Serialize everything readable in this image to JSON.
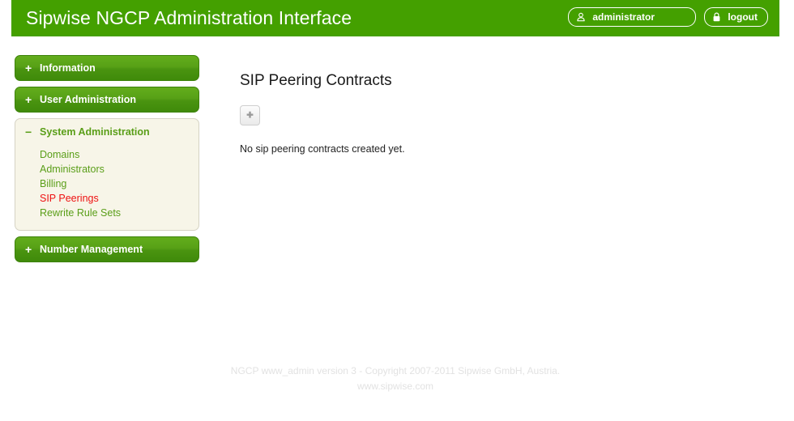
{
  "header": {
    "title": "Sipwise NGCP Administration Interface",
    "brand_green": "#44a000",
    "user_button": {
      "label": "administrator",
      "icon": "user-icon"
    },
    "logout_button": {
      "label": "logout",
      "icon": "lock-icon"
    }
  },
  "sidebar": {
    "items": [
      {
        "label": "Information",
        "sign": "+",
        "expanded": false
      },
      {
        "label": "User Administration",
        "sign": "+",
        "expanded": false
      },
      {
        "label": "System Administration",
        "sign": "−",
        "expanded": true,
        "children": [
          {
            "label": "Domains",
            "active": false
          },
          {
            "label": "Administrators",
            "active": false
          },
          {
            "label": "Billing",
            "active": false
          },
          {
            "label": "SIP Peerings",
            "active": true
          },
          {
            "label": "Rewrite Rule Sets",
            "active": false
          }
        ]
      },
      {
        "label": "Number Management",
        "sign": "+",
        "expanded": false
      }
    ],
    "active_color": "#ee1111",
    "link_color": "#5a9e18"
  },
  "main": {
    "title": "SIP Peering Contracts",
    "add_button": {
      "label": "+",
      "icon": "plus-icon"
    },
    "empty_message": "No sip peering contracts created yet."
  },
  "footer": {
    "line1": "NGCP www_admin version 3 - Copyright 2007-2011 Sipwise GmbH, Austria.",
    "line2": "www.sipwise.com"
  }
}
